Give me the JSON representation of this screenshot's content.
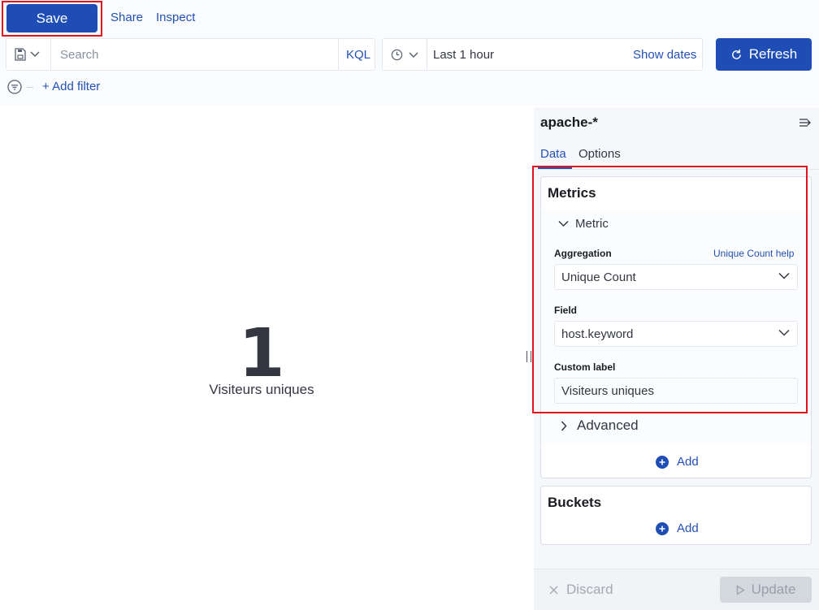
{
  "toolbar": {
    "save_label": "Save",
    "share_label": "Share",
    "inspect_label": "Inspect"
  },
  "query_bar": {
    "search_placeholder": "Search",
    "language_label": "KQL",
    "time_range": "Last 1 hour",
    "show_dates_label": "Show dates",
    "refresh_label": "Refresh",
    "add_filter_label": "+ Add filter"
  },
  "visualization": {
    "value": "1",
    "label": "Visiteurs uniques"
  },
  "sidebar": {
    "index_pattern": "apache-*",
    "tabs": [
      {
        "label": "Data",
        "active": true
      },
      {
        "label": "Options",
        "active": false
      }
    ],
    "metrics": {
      "title": "Metrics",
      "metric_accordion_label": "Metric",
      "aggregation_label": "Aggregation",
      "aggregation_help_link": "Unique Count help",
      "aggregation_value": "Unique Count",
      "field_label": "Field",
      "field_value": "host.keyword",
      "custom_label_label": "Custom label",
      "custom_label_value": "Visiteurs uniques",
      "advanced_label": "Advanced",
      "add_label": "Add"
    },
    "buckets": {
      "title": "Buckets",
      "add_label": "Add"
    },
    "footer": {
      "discard_label": "Discard",
      "update_label": "Update"
    }
  },
  "colors": {
    "primary": "#1e4eb5",
    "link": "#2250b6",
    "highlight_frame": "#e0141e"
  },
  "icons": [
    "save-query-icon",
    "chevron-down-icon",
    "clock-icon",
    "refresh-icon",
    "filter-icon",
    "collapse-panel-icon",
    "plus-circle-icon",
    "chevron-right-icon",
    "close-icon",
    "play-icon"
  ]
}
